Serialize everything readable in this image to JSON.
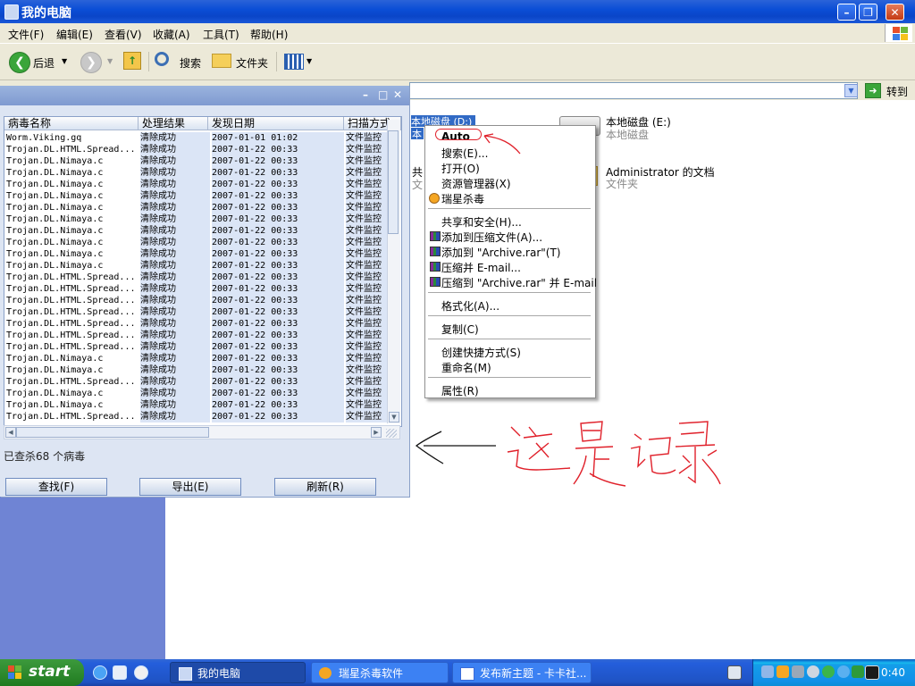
{
  "window": {
    "title": "我的电脑",
    "caption_buttons": [
      "minimize",
      "maximize",
      "close"
    ]
  },
  "menubar": [
    "文件(F)",
    "编辑(E)",
    "查看(V)",
    "收藏(A)",
    "工具(T)",
    "帮助(H)"
  ],
  "toolbar": {
    "back": "后退",
    "search": "搜索",
    "folders": "文件夹"
  },
  "address": {
    "go": "转到"
  },
  "drives": [
    {
      "name": "本地磁盘 (D:)",
      "sub": "本",
      "selected": true
    },
    {
      "name": "本地磁盘 (E:)",
      "sub": "本地磁盘"
    },
    {
      "name": "共",
      "sub": "文"
    },
    {
      "name": "Administrator 的文档",
      "sub": "文件夹"
    }
  ],
  "context_menu": {
    "items": [
      {
        "label": "Auto",
        "bold": true
      },
      {
        "label": "搜索(E)..."
      },
      {
        "label": "打开(O)"
      },
      {
        "label": "资源管理器(X)"
      },
      {
        "label": "瑞星杀毒",
        "icon": "rising-antivirus-icon"
      },
      {
        "sep": true
      },
      {
        "label": "共享和安全(H)..."
      },
      {
        "label": "添加到压缩文件(A)...",
        "icon": "winrar-icon"
      },
      {
        "label": "添加到 \"Archive.rar\"(T)",
        "icon": "winrar-icon"
      },
      {
        "label": "压缩并 E-mail...",
        "icon": "winrar-icon"
      },
      {
        "label": "压缩到 \"Archive.rar\" 并 E-mail",
        "icon": "winrar-icon"
      },
      {
        "sep": true
      },
      {
        "label": "格式化(A)..."
      },
      {
        "sep": true
      },
      {
        "label": "复制(C)"
      },
      {
        "sep": true
      },
      {
        "label": "创建快捷方式(S)"
      },
      {
        "label": "重命名(M)"
      },
      {
        "sep": true
      },
      {
        "label": "属性(R)"
      }
    ]
  },
  "scan_log": {
    "columns": [
      "病毒名称",
      "处理结果",
      "发现日期",
      "扫描方式"
    ],
    "rows": [
      [
        "Worm.Viking.gq",
        "清除成功",
        "2007-01-01 01:02",
        "文件监控"
      ],
      [
        "Trojan.DL.HTML.Spread...",
        "清除成功",
        "2007-01-22 00:33",
        "文件监控"
      ],
      [
        "Trojan.DL.Nimaya.c",
        "清除成功",
        "2007-01-22 00:33",
        "文件监控"
      ],
      [
        "Trojan.DL.Nimaya.c",
        "清除成功",
        "2007-01-22 00:33",
        "文件监控"
      ],
      [
        "Trojan.DL.Nimaya.c",
        "清除成功",
        "2007-01-22 00:33",
        "文件监控"
      ],
      [
        "Trojan.DL.Nimaya.c",
        "清除成功",
        "2007-01-22 00:33",
        "文件监控"
      ],
      [
        "Trojan.DL.Nimaya.c",
        "清除成功",
        "2007-01-22 00:33",
        "文件监控"
      ],
      [
        "Trojan.DL.Nimaya.c",
        "清除成功",
        "2007-01-22 00:33",
        "文件监控"
      ],
      [
        "Trojan.DL.Nimaya.c",
        "清除成功",
        "2007-01-22 00:33",
        "文件监控"
      ],
      [
        "Trojan.DL.Nimaya.c",
        "清除成功",
        "2007-01-22 00:33",
        "文件监控"
      ],
      [
        "Trojan.DL.Nimaya.c",
        "清除成功",
        "2007-01-22 00:33",
        "文件监控"
      ],
      [
        "Trojan.DL.Nimaya.c",
        "清除成功",
        "2007-01-22 00:33",
        "文件监控"
      ],
      [
        "Trojan.DL.HTML.Spread...",
        "清除成功",
        "2007-01-22 00:33",
        "文件监控"
      ],
      [
        "Trojan.DL.HTML.Spread...",
        "清除成功",
        "2007-01-22 00:33",
        "文件监控"
      ],
      [
        "Trojan.DL.HTML.Spread...",
        "清除成功",
        "2007-01-22 00:33",
        "文件监控"
      ],
      [
        "Trojan.DL.HTML.Spread...",
        "清除成功",
        "2007-01-22 00:33",
        "文件监控"
      ],
      [
        "Trojan.DL.HTML.Spread...",
        "清除成功",
        "2007-01-22 00:33",
        "文件监控"
      ],
      [
        "Trojan.DL.HTML.Spread...",
        "清除成功",
        "2007-01-22 00:33",
        "文件监控"
      ],
      [
        "Trojan.DL.HTML.Spread...",
        "清除成功",
        "2007-01-22 00:33",
        "文件监控"
      ],
      [
        "Trojan.DL.Nimaya.c",
        "清除成功",
        "2007-01-22 00:33",
        "文件监控"
      ],
      [
        "Trojan.DL.Nimaya.c",
        "清除成功",
        "2007-01-22 00:33",
        "文件监控"
      ],
      [
        "Trojan.DL.HTML.Spread...",
        "清除成功",
        "2007-01-22 00:33",
        "文件监控"
      ],
      [
        "Trojan.DL.Nimaya.c",
        "清除成功",
        "2007-01-22 00:33",
        "文件监控"
      ],
      [
        "Trojan.DL.Nimaya.c",
        "清除成功",
        "2007-01-22 00:33",
        "文件监控"
      ],
      [
        "Trojan.DL.HTML.Spread...",
        "清除成功",
        "2007-01-22 00:33",
        "文件监控"
      ]
    ],
    "status": "已查杀68 个病毒",
    "buttons": [
      "查找(F)",
      "导出(E)",
      "刷新(R)"
    ]
  },
  "annotation": {
    "handwriting": "这是记录"
  },
  "taskbar": {
    "start": "start",
    "tasks": [
      {
        "label": "我的电脑",
        "active": true
      },
      {
        "label": "瑞星杀毒软件",
        "active": false
      },
      {
        "label": "发布新主题 - 卡卡社...",
        "active": false
      }
    ],
    "clock": "0:40"
  },
  "colors": {
    "title_blue": "#0b4ed6",
    "annotation_red": "#e0202a",
    "taskbar_blue": "#245edb",
    "start_green": "#2f8b2f"
  }
}
